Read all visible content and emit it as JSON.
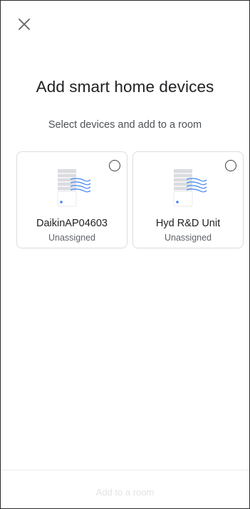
{
  "header": {
    "close_icon": "close-icon",
    "title": "Add smart home devices",
    "subtitle": "Select devices and add to a room"
  },
  "devices": [
    {
      "name": "DaikinAP04603",
      "status": "Unassigned",
      "icon": "air-conditioner-icon",
      "selected": false
    },
    {
      "name": "Hyd R&D Unit",
      "status": "Unassigned",
      "icon": "air-conditioner-icon",
      "selected": false
    }
  ],
  "footer": {
    "action_label": "Add to a room",
    "enabled": false
  },
  "colors": {
    "text_primary": "#202124",
    "text_secondary": "#5f6368",
    "card_border": "#dadce0",
    "icon_accent": "#4285f4",
    "disabled_text": "#e3e3e3"
  }
}
